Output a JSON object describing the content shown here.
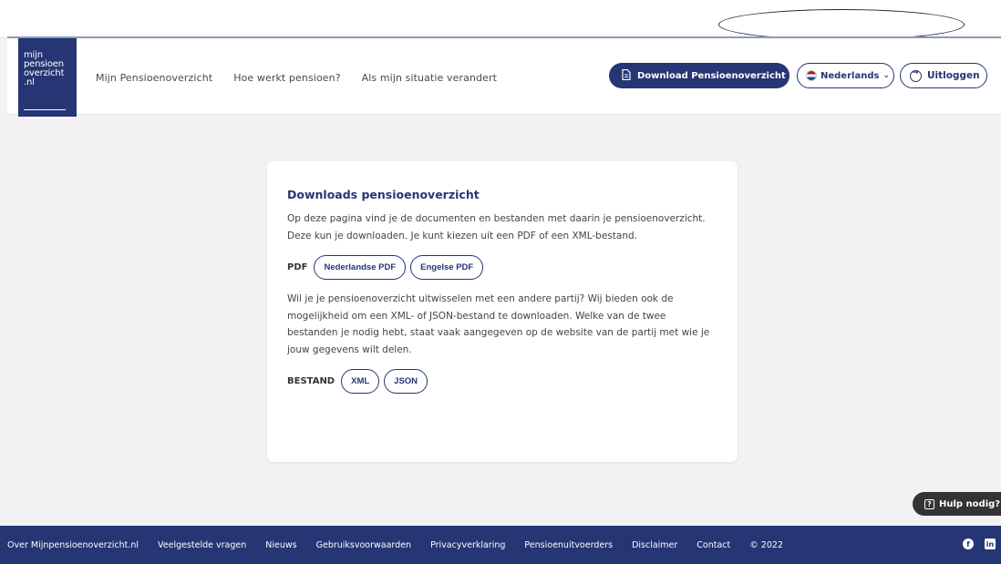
{
  "logo": {
    "lines": [
      "mijn",
      "pensioen",
      "overzicht",
      ".nl"
    ]
  },
  "nav": {
    "items": [
      {
        "label": "Mijn Pensioenoverzicht"
      },
      {
        "label": "Hoe werkt pensioen?"
      },
      {
        "label": "Als mijn situatie verandert"
      }
    ]
  },
  "header": {
    "download_label": "Download Pensioenoverzicht",
    "language_label": "Nederlands",
    "logout_label": "Uitloggen"
  },
  "card": {
    "title": "Downloads pensioenoverzicht",
    "intro": "Op deze pagina vind je de documenten en bestanden met daarin je pensioenoverzicht. Deze kun je downloaden. Je kunt kiezen uit een PDF of een XML-bestand.",
    "pdf_label": "PDF",
    "pdf_buttons": [
      "Nederlandse PDF",
      "Engelse PDF"
    ],
    "exchange_text": "Wil je je pensioenoverzicht uitwisselen met een andere partij? Wij bieden ook de mogelijkheid om een XML- of JSON-bestand te downloaden. Welke van de twee bestanden je nodig hebt, staat vaak aangegeven op de website van de partij met wie je jouw gegevens wilt delen.",
    "file_label": "BESTAND",
    "file_buttons": [
      "XML",
      "JSON"
    ]
  },
  "help": {
    "label": "Hulp nodig?"
  },
  "footer": {
    "links": [
      "Over Mijnpensioenoverzicht.nl",
      "Veelgestelde vragen",
      "Nieuws",
      "Gebruiksvoorwaarden",
      "Privacyverklaring",
      "Pensioenuitvoerders",
      "Disclaimer",
      "Contact",
      "© 2022"
    ]
  },
  "colors": {
    "brand": "#263574",
    "background": "#f2f2f2",
    "help_bg": "#333333"
  },
  "icons": [
    "document-icon",
    "flag-nl-icon",
    "chevron-down-icon",
    "logout-icon",
    "help-icon",
    "facebook-icon",
    "linkedin-icon"
  ]
}
